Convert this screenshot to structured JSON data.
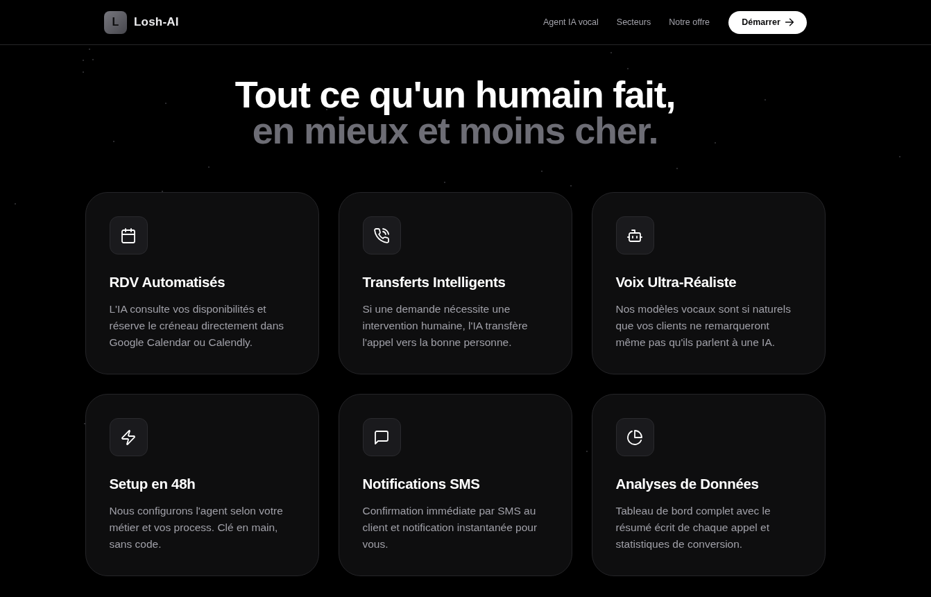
{
  "header": {
    "logo": {
      "letter": "L",
      "name": "Losh-AI"
    },
    "nav": [
      "Agent IA vocal",
      "Secteurs",
      "Notre offre"
    ],
    "cta": "Démarrer"
  },
  "hero": {
    "title_line_1": "Tout ce qu'un humain fait,",
    "title_line_2": "en mieux et moins cher."
  },
  "features": [
    {
      "title": "RDV Automatisés",
      "description": "L'IA consulte vos disponibilités et réserve le créneau directement dans Google Calendar ou Calendly."
    },
    {
      "title": "Transferts Intelligents",
      "description": "Si une demande nécessite une intervention humaine, l'IA transfère l'appel vers la bonne personne."
    },
    {
      "title": "Voix Ultra-Réaliste",
      "description": "Nos modèles vocaux sont si naturels que vos clients ne remarqueront même pas qu'ils parlent à une IA."
    },
    {
      "title": "Setup en 48h",
      "description": "Nous configurons l'agent selon votre métier et vos process. Clé en main, sans code."
    },
    {
      "title": "Notifications SMS",
      "description": "Confirmation immédiate par SMS au client et notification instantanée pour vous."
    },
    {
      "title": "Analyses de Données",
      "description": "Tableau de bord complet avec le résumé écrit de chaque appel et statistiques de conversion."
    }
  ]
}
